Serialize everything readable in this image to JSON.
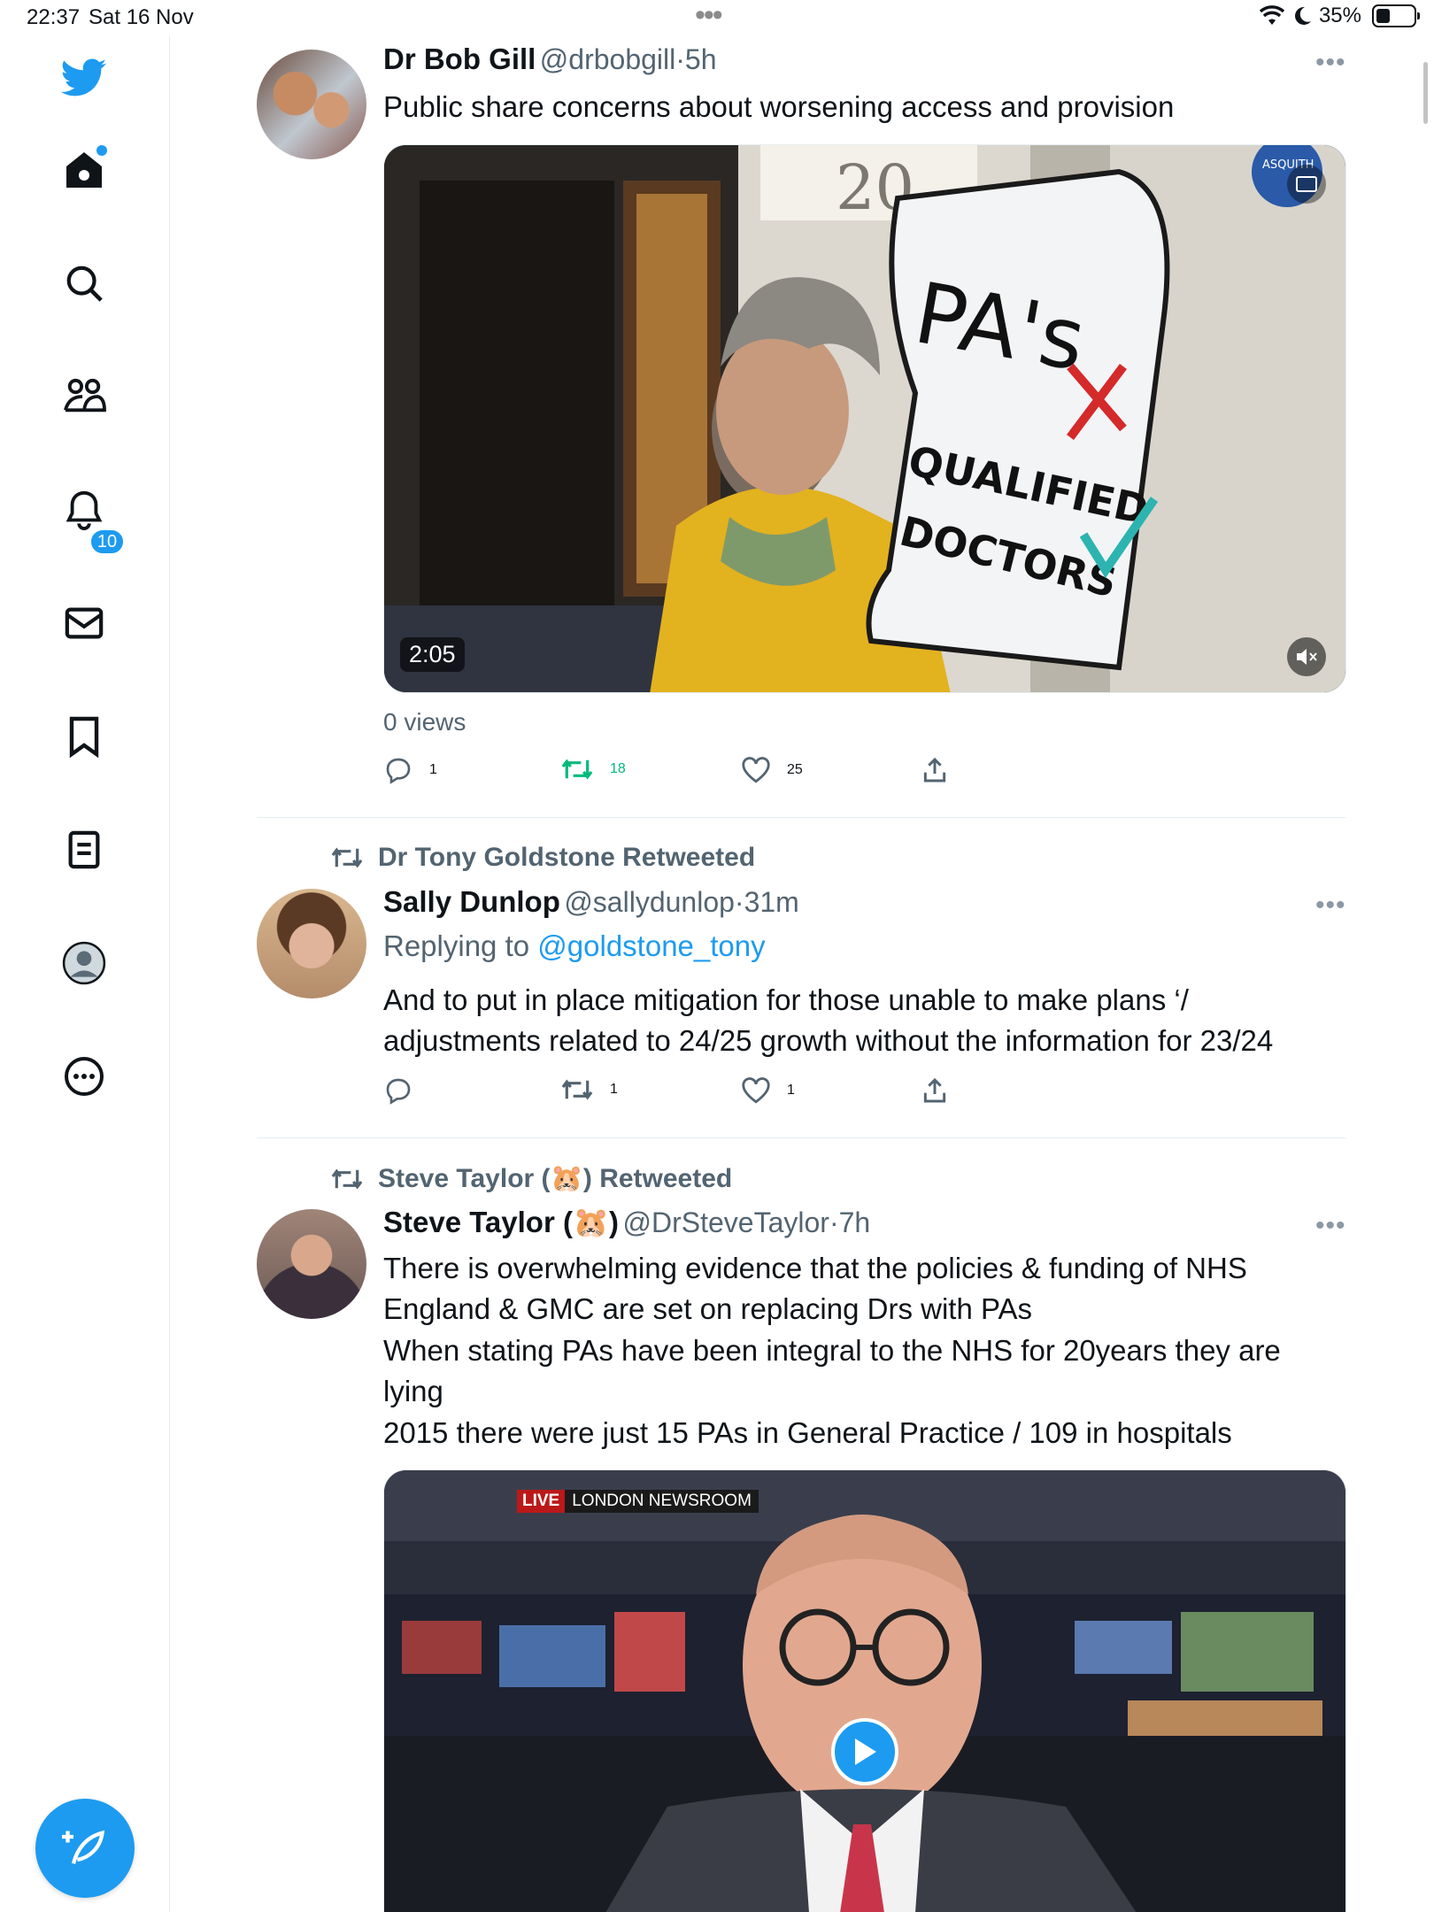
{
  "status_bar": {
    "time": "22:37",
    "date": "Sat 16 Nov",
    "battery": "35%"
  },
  "sidebar": {
    "items": [
      {
        "name": "home",
        "active": true
      },
      {
        "name": "explore"
      },
      {
        "name": "communities"
      },
      {
        "name": "notifications",
        "badge": "10"
      },
      {
        "name": "messages"
      },
      {
        "name": "bookmarks"
      },
      {
        "name": "lists"
      },
      {
        "name": "profile"
      },
      {
        "name": "more"
      }
    ],
    "brand_color": "#1d9bf0"
  },
  "tweets": [
    {
      "author": "Dr Bob Gill",
      "handle": "@drbobgill",
      "time": "5h",
      "text": "Public share concerns about worsening access and provision",
      "media": {
        "type": "video",
        "duration": "2:05",
        "sign_text_1": "PA's",
        "sign_text_2": "QUALIFIED",
        "sign_text_3": "DOCTORS",
        "door_number": "20",
        "plaque_text": "ASQUITH"
      },
      "views": "0 views",
      "replies": "1",
      "retweets": "18",
      "likes": "25"
    },
    {
      "retweeted_by": "Dr Tony Goldstone Retweeted",
      "author": "Sally Dunlop",
      "handle": "@sallydunlop",
      "time": "31m",
      "replying_label": "Replying to",
      "replying_to": "@goldstone_tony",
      "text_line1": "And to put in place mitigation for those unable to make plans ‘/",
      "text_line2": "adjustments related to 24/25 growth without the information for 23/24",
      "replies": "",
      "retweets": "1",
      "likes": "1"
    },
    {
      "retweeted_by": "Steve Taylor (🐹) Retweeted",
      "author": "Steve Taylor (🐹)",
      "handle": "@DrSteveTaylor",
      "time": "7h",
      "text_lines": [
        "There is overwhelming evidence that the policies & funding of NHS",
        "England & GMC are set on replacing Drs with PAs",
        "When stating PAs have been integral to the NHS for 20years they are",
        "lying",
        "2015 there were just 15 PAs in General Practice / 109 in hospitals"
      ],
      "media": {
        "type": "video",
        "live_label": "LIVE",
        "channel_label": "LONDON NEWSROOM"
      }
    }
  ]
}
